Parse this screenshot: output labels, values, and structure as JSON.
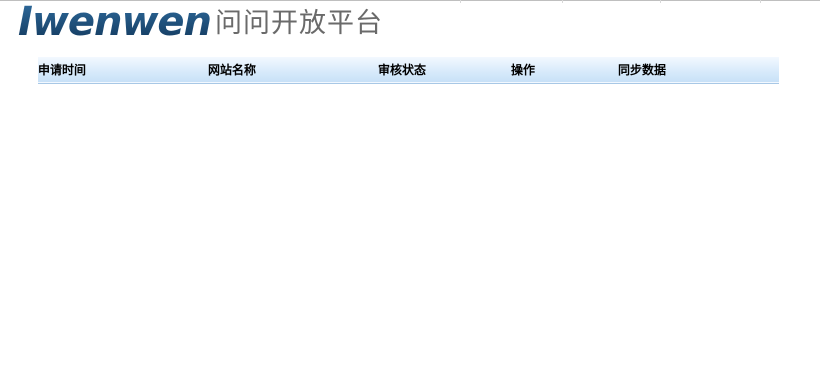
{
  "logo": {
    "brand": "Iwenwen",
    "subtitle": "问问开放平台"
  },
  "table": {
    "columns": [
      "申请时间",
      "网站名称",
      "审核状态",
      "操作",
      "同步数据"
    ],
    "rows": []
  },
  "colors": {
    "brand": "#1d4a74",
    "header_bg": "#d9ebfb",
    "header_border": "#a8c8e6"
  }
}
